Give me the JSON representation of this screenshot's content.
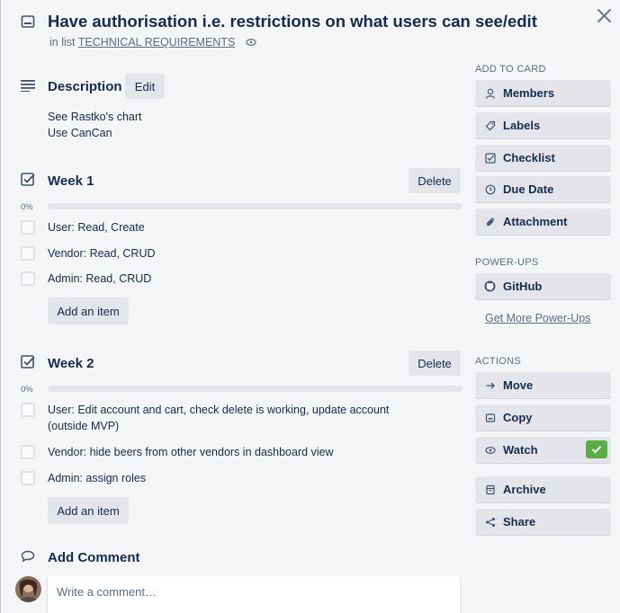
{
  "card": {
    "title": "Have authorisation i.e. restrictions on what users can see/edit",
    "in_list_prefix": "in list",
    "list_name": "TECHNICAL REQUIREMENTS"
  },
  "description": {
    "title": "Description",
    "edit_label": "Edit",
    "lines": [
      "See Rastko's chart",
      "Use CanCan"
    ]
  },
  "checklists": [
    {
      "title": "Week 1",
      "delete_label": "Delete",
      "percent": "0%",
      "progress": 0,
      "items": [
        "User: Read, Create",
        "Vendor: Read, CRUD",
        "Admin: Read, CRUD"
      ],
      "add_label": "Add an item"
    },
    {
      "title": "Week 2",
      "delete_label": "Delete",
      "percent": "0%",
      "progress": 0,
      "items": [
        "User: Edit account and cart, check delete is working, update account",
        "(outside MVP)",
        "Vendor: hide beers from other vendors in dashboard view",
        "Admin: assign roles"
      ],
      "add_label": "Add an item"
    }
  ],
  "comment": {
    "title": "Add Comment",
    "placeholder": "Write a comment…"
  },
  "sidebar": {
    "add_to_card": "ADD TO CARD",
    "add_items": [
      {
        "label": "Members",
        "icon": "person-icon"
      },
      {
        "label": "Labels",
        "icon": "tag-icon"
      },
      {
        "label": "Checklist",
        "icon": "checklist-icon"
      },
      {
        "label": "Due Date",
        "icon": "clock-icon"
      },
      {
        "label": "Attachment",
        "icon": "paperclip-icon"
      }
    ],
    "power_ups": "POWER-UPS",
    "github_label": "GitHub",
    "get_more": "Get More Power-Ups",
    "actions": "ACTIONS",
    "action_items": [
      {
        "label": "Move",
        "icon": "arrow-right-icon"
      },
      {
        "label": "Copy",
        "icon": "copy-icon"
      },
      {
        "label": "Watch",
        "icon": "eye-icon",
        "checked": true
      },
      {
        "label": "Archive",
        "icon": "archive-icon"
      },
      {
        "label": "Share",
        "icon": "share-icon"
      }
    ]
  },
  "colors": {
    "background": "#f4f5f7",
    "button": "#e3e5ea",
    "text": "#172b4d",
    "muted": "#5e6c84",
    "watch_check": "#5aac44"
  }
}
